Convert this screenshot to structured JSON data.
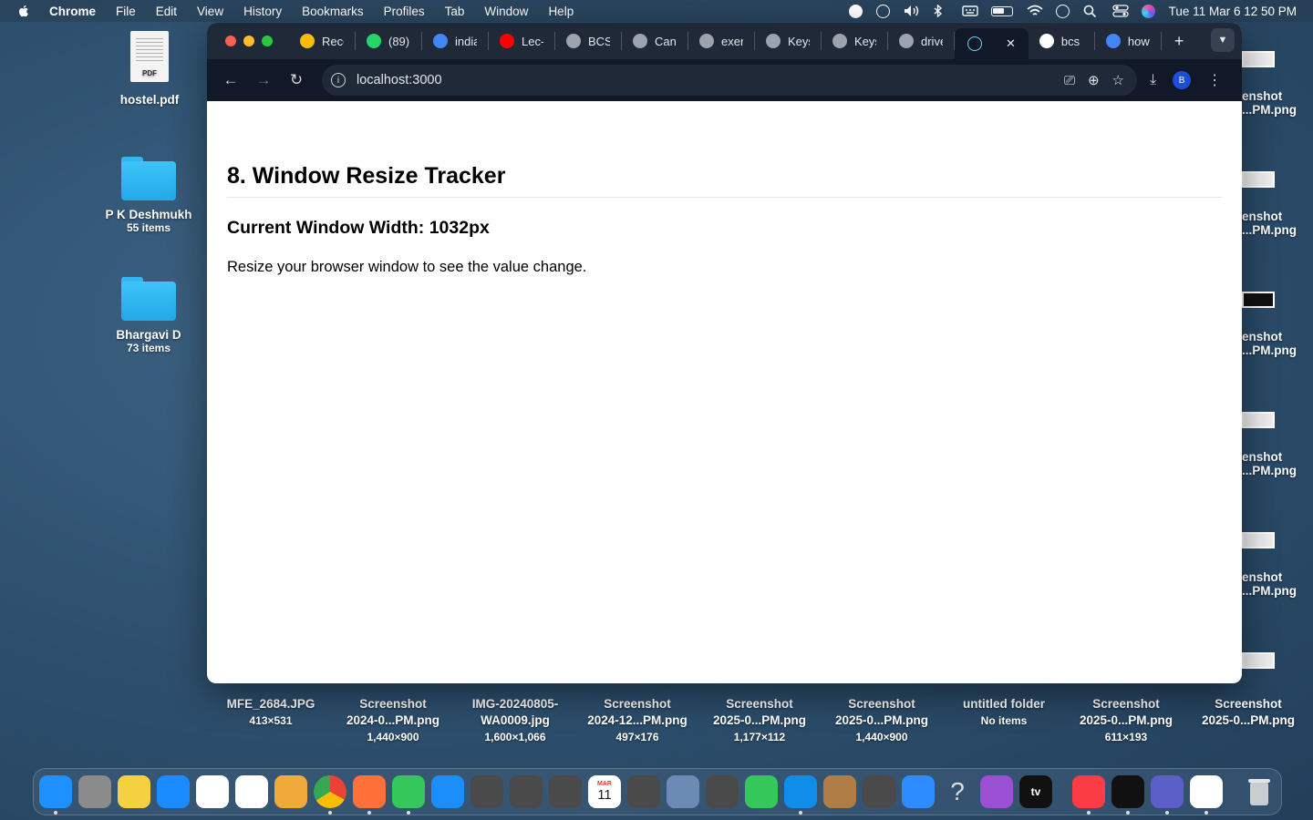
{
  "menubar": {
    "app_name": "Chrome",
    "items": [
      "File",
      "Edit",
      "View",
      "History",
      "Bookmarks",
      "Profiles",
      "Tab",
      "Window",
      "Help"
    ],
    "clock": "Tue 11 Mar  6 12 50 PM"
  },
  "desktop": {
    "left_items": [
      {
        "name": "hostel.pdf",
        "sub": "",
        "icon_label": "PDF"
      },
      {
        "name": "P K Deshmukh",
        "sub": "55 items"
      },
      {
        "name": "Bhargavi D",
        "sub": "73 items"
      }
    ],
    "right_items": [
      {
        "name": "enshot",
        "sub": "...PM.png"
      },
      {
        "name": "enshot",
        "sub": "...PM.png"
      },
      {
        "name": "enshot",
        "sub": "...PM.png"
      },
      {
        "name": "enshot",
        "sub": "...PM.png"
      },
      {
        "name": "enshot",
        "sub": "...PM.png"
      }
    ],
    "bottom_items": [
      {
        "name": "MFE_2684.JPG",
        "line2": "",
        "dims": "413×531"
      },
      {
        "name": "Screenshot",
        "line2": "2024-0...PM.png",
        "dims": "1,440×900"
      },
      {
        "name": "IMG-20240805-",
        "line2": "WA0009.jpg",
        "dims": "1,600×1,066"
      },
      {
        "name": "Screenshot",
        "line2": "2024-12...PM.png",
        "dims": "497×176"
      },
      {
        "name": "Screenshot",
        "line2": "2025-0...PM.png",
        "dims": "1,177×112"
      },
      {
        "name": "Screenshot",
        "line2": "2025-0...PM.png",
        "dims": "1,440×900"
      },
      {
        "name": "untitled folder",
        "line2": "",
        "dims": "No items"
      },
      {
        "name": "Screenshot",
        "line2": "2025-0...PM.png",
        "dims": "611×193"
      },
      {
        "name": "Screenshot",
        "line2": "2025-0...PM.png",
        "dims": ""
      }
    ]
  },
  "browser": {
    "tabs": [
      {
        "label": "Reco",
        "color": "#fbbc04"
      },
      {
        "label": "(89)",
        "color": "#25d366"
      },
      {
        "label": "india",
        "color": "#4285f4"
      },
      {
        "label": "Lec-",
        "color": "#ff0000"
      },
      {
        "label": "BCS",
        "color": "#9ca3af"
      },
      {
        "label": "Can",
        "color": "#9ca3af"
      },
      {
        "label": "exer",
        "color": "#9ca3af"
      },
      {
        "label": "Keys",
        "color": "#9ca3af"
      },
      {
        "label": "Keys",
        "color": "#9ca3af"
      },
      {
        "label": "drive",
        "color": "#9ca3af"
      }
    ],
    "active_tab": {
      "label": "",
      "close": "✕"
    },
    "after_tabs": [
      {
        "label": "bcs",
        "color": "#ffffff"
      },
      {
        "label": "how",
        "color": "#4285f4"
      }
    ],
    "new_tab": "+",
    "address": "localhost:3000",
    "profile_initial": "B"
  },
  "page": {
    "title": "8. Window Resize Tracker",
    "width_text": "Current Window Width: 1032px",
    "instruction": "Resize your browser window to see the value change."
  },
  "dock": {
    "apps": [
      {
        "name": "finder",
        "color": "#1e90ff"
      },
      {
        "name": "launchpad",
        "color": "#8b8b8b"
      },
      {
        "name": "notes",
        "color": "#f5d142"
      },
      {
        "name": "safari",
        "color": "#1a8cff"
      },
      {
        "name": "photos",
        "color": "#ffffff"
      },
      {
        "name": "reminders",
        "color": "#ffffff"
      },
      {
        "name": "pages",
        "color": "#f2a93b"
      },
      {
        "name": "chrome",
        "color": "#ffffff"
      },
      {
        "name": "firefox",
        "color": "#ff7139"
      },
      {
        "name": "messages",
        "color": "#34c759"
      },
      {
        "name": "app-store",
        "color": "#1c8ef9"
      },
      {
        "name": "app-1",
        "color": "#4a4a4a"
      },
      {
        "name": "app-2",
        "color": "#4a4a4a"
      },
      {
        "name": "app-3",
        "color": "#4a4a4a"
      },
      {
        "name": "calendar",
        "color": "#ffffff"
      },
      {
        "name": "app-4",
        "color": "#4a4a4a"
      },
      {
        "name": "preview",
        "color": "#6b8bb5"
      },
      {
        "name": "app-5",
        "color": "#4a4a4a"
      },
      {
        "name": "facetime",
        "color": "#34c759"
      },
      {
        "name": "teamviewer",
        "color": "#0e8ee9"
      },
      {
        "name": "contacts",
        "color": "#b07d46"
      },
      {
        "name": "app-6",
        "color": "#4a4a4a"
      },
      {
        "name": "mail",
        "color": "#2d8cff"
      },
      {
        "name": "help",
        "color": "transparent"
      },
      {
        "name": "podcasts",
        "color": "#9b4fd5"
      },
      {
        "name": "apple-tv",
        "color": "#111111"
      }
    ],
    "apps_after": [
      {
        "name": "music",
        "color": "#fc3c44"
      },
      {
        "name": "activity-monitor",
        "color": "#111111"
      },
      {
        "name": "teams",
        "color": "#5b5fc7"
      },
      {
        "name": "vscode",
        "color": "#ffffff"
      }
    ],
    "calendar_day": "11",
    "calendar_month": "MAR",
    "tv_label": "tv"
  }
}
